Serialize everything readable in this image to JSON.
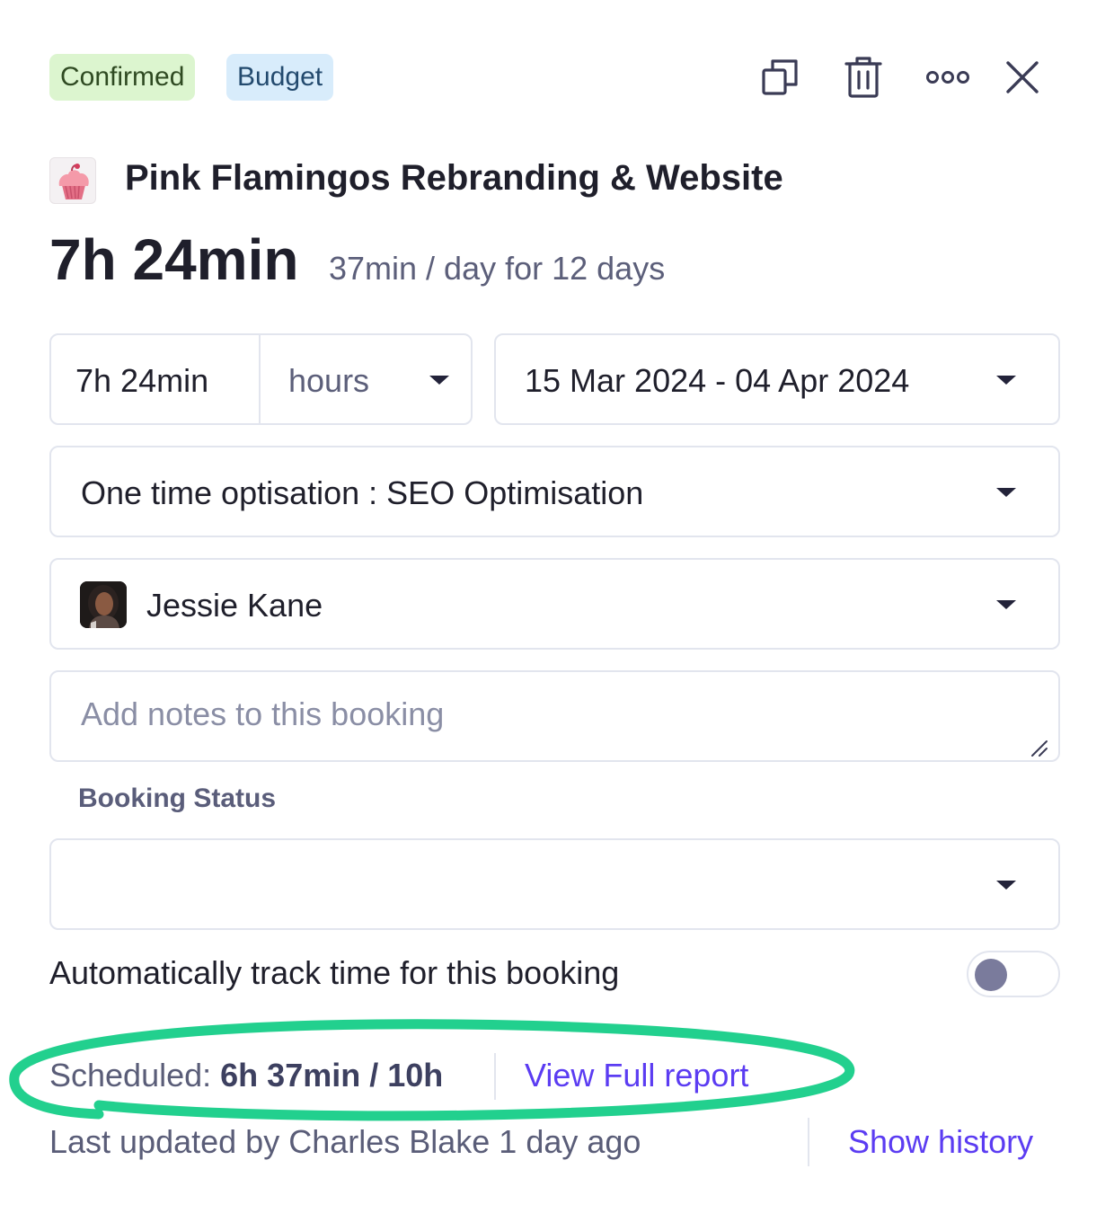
{
  "header": {
    "badges": {
      "confirmed": "Confirmed",
      "budget": "Budget"
    },
    "actions": [
      "duplicate-icon",
      "trash-icon",
      "more-icon",
      "close-icon"
    ]
  },
  "project": {
    "title": "Pink Flamingos Rebranding & Website",
    "logo": "cupcake-icon"
  },
  "summary": {
    "total": "7h 24min",
    "per_day": "37min / day for 12 days"
  },
  "booking": {
    "duration_value": "7h 24min",
    "duration_unit": "hours",
    "date_range": "15 Mar 2024 - 04 Apr 2024",
    "service": "One time optisation : SEO Optimisation",
    "person": "Jessie Kane",
    "notes_placeholder": "Add notes to this booking",
    "status_label": "Booking Status",
    "status_value": ""
  },
  "auto_track": {
    "label": "Automatically track time for this booking",
    "enabled": false
  },
  "footer": {
    "scheduled_label": "Scheduled:",
    "scheduled_value": "6h 37min / 10h",
    "view_report": "View Full report",
    "last_updated": "Last updated by Charles Blake 1 day ago",
    "show_history": "Show history"
  },
  "colors": {
    "confirmed_bg": "#dcf5cf",
    "budget_bg": "#d8ecfb",
    "link": "#5b3cf2",
    "highlight": "#22d08e"
  }
}
